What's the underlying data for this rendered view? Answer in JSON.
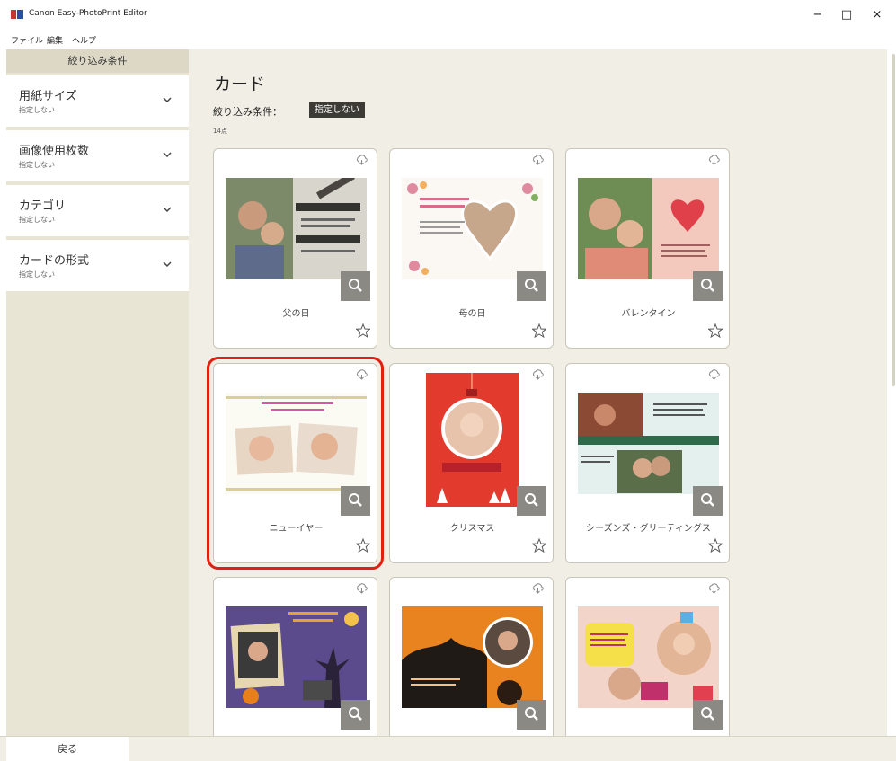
{
  "window": {
    "title": "Canon Easy-PhotoPrint Editor",
    "minimize": "−",
    "maximize": "□",
    "close": "×"
  },
  "menu": [
    "ファイル",
    "編集",
    "ヘルプ"
  ],
  "sidebar": {
    "header": "絞り込み条件",
    "filters": [
      {
        "title": "用紙サイズ",
        "value": "指定しない"
      },
      {
        "title": "画像使用枚数",
        "value": "指定しない"
      },
      {
        "title": "カテゴリ",
        "value": "指定しない"
      },
      {
        "title": "カードの形式",
        "value": "指定しない"
      }
    ]
  },
  "main": {
    "title": "カード",
    "filter_label": "絞り込み条件：",
    "filter_chip": "指定しない",
    "count": "14点",
    "cards": [
      {
        "label": "父の日",
        "selected": false
      },
      {
        "label": "母の日",
        "selected": false
      },
      {
        "label": "バレンタイン",
        "selected": false
      },
      {
        "label": "ニューイヤー",
        "selected": true
      },
      {
        "label": "クリスマス",
        "selected": false
      },
      {
        "label": "シーズンズ・グリーティングス",
        "selected": false
      },
      {
        "label": "",
        "selected": false
      },
      {
        "label": "",
        "selected": false
      },
      {
        "label": "",
        "selected": false
      }
    ]
  },
  "footer": {
    "back": "戻る"
  },
  "colors": {
    "sidebar_bg": "#e9e5d5",
    "main_bg": "#f1efe5",
    "chip_bg": "#3d3b36",
    "selection_outline": "#e02010",
    "zoom_button": "#8b8984"
  }
}
